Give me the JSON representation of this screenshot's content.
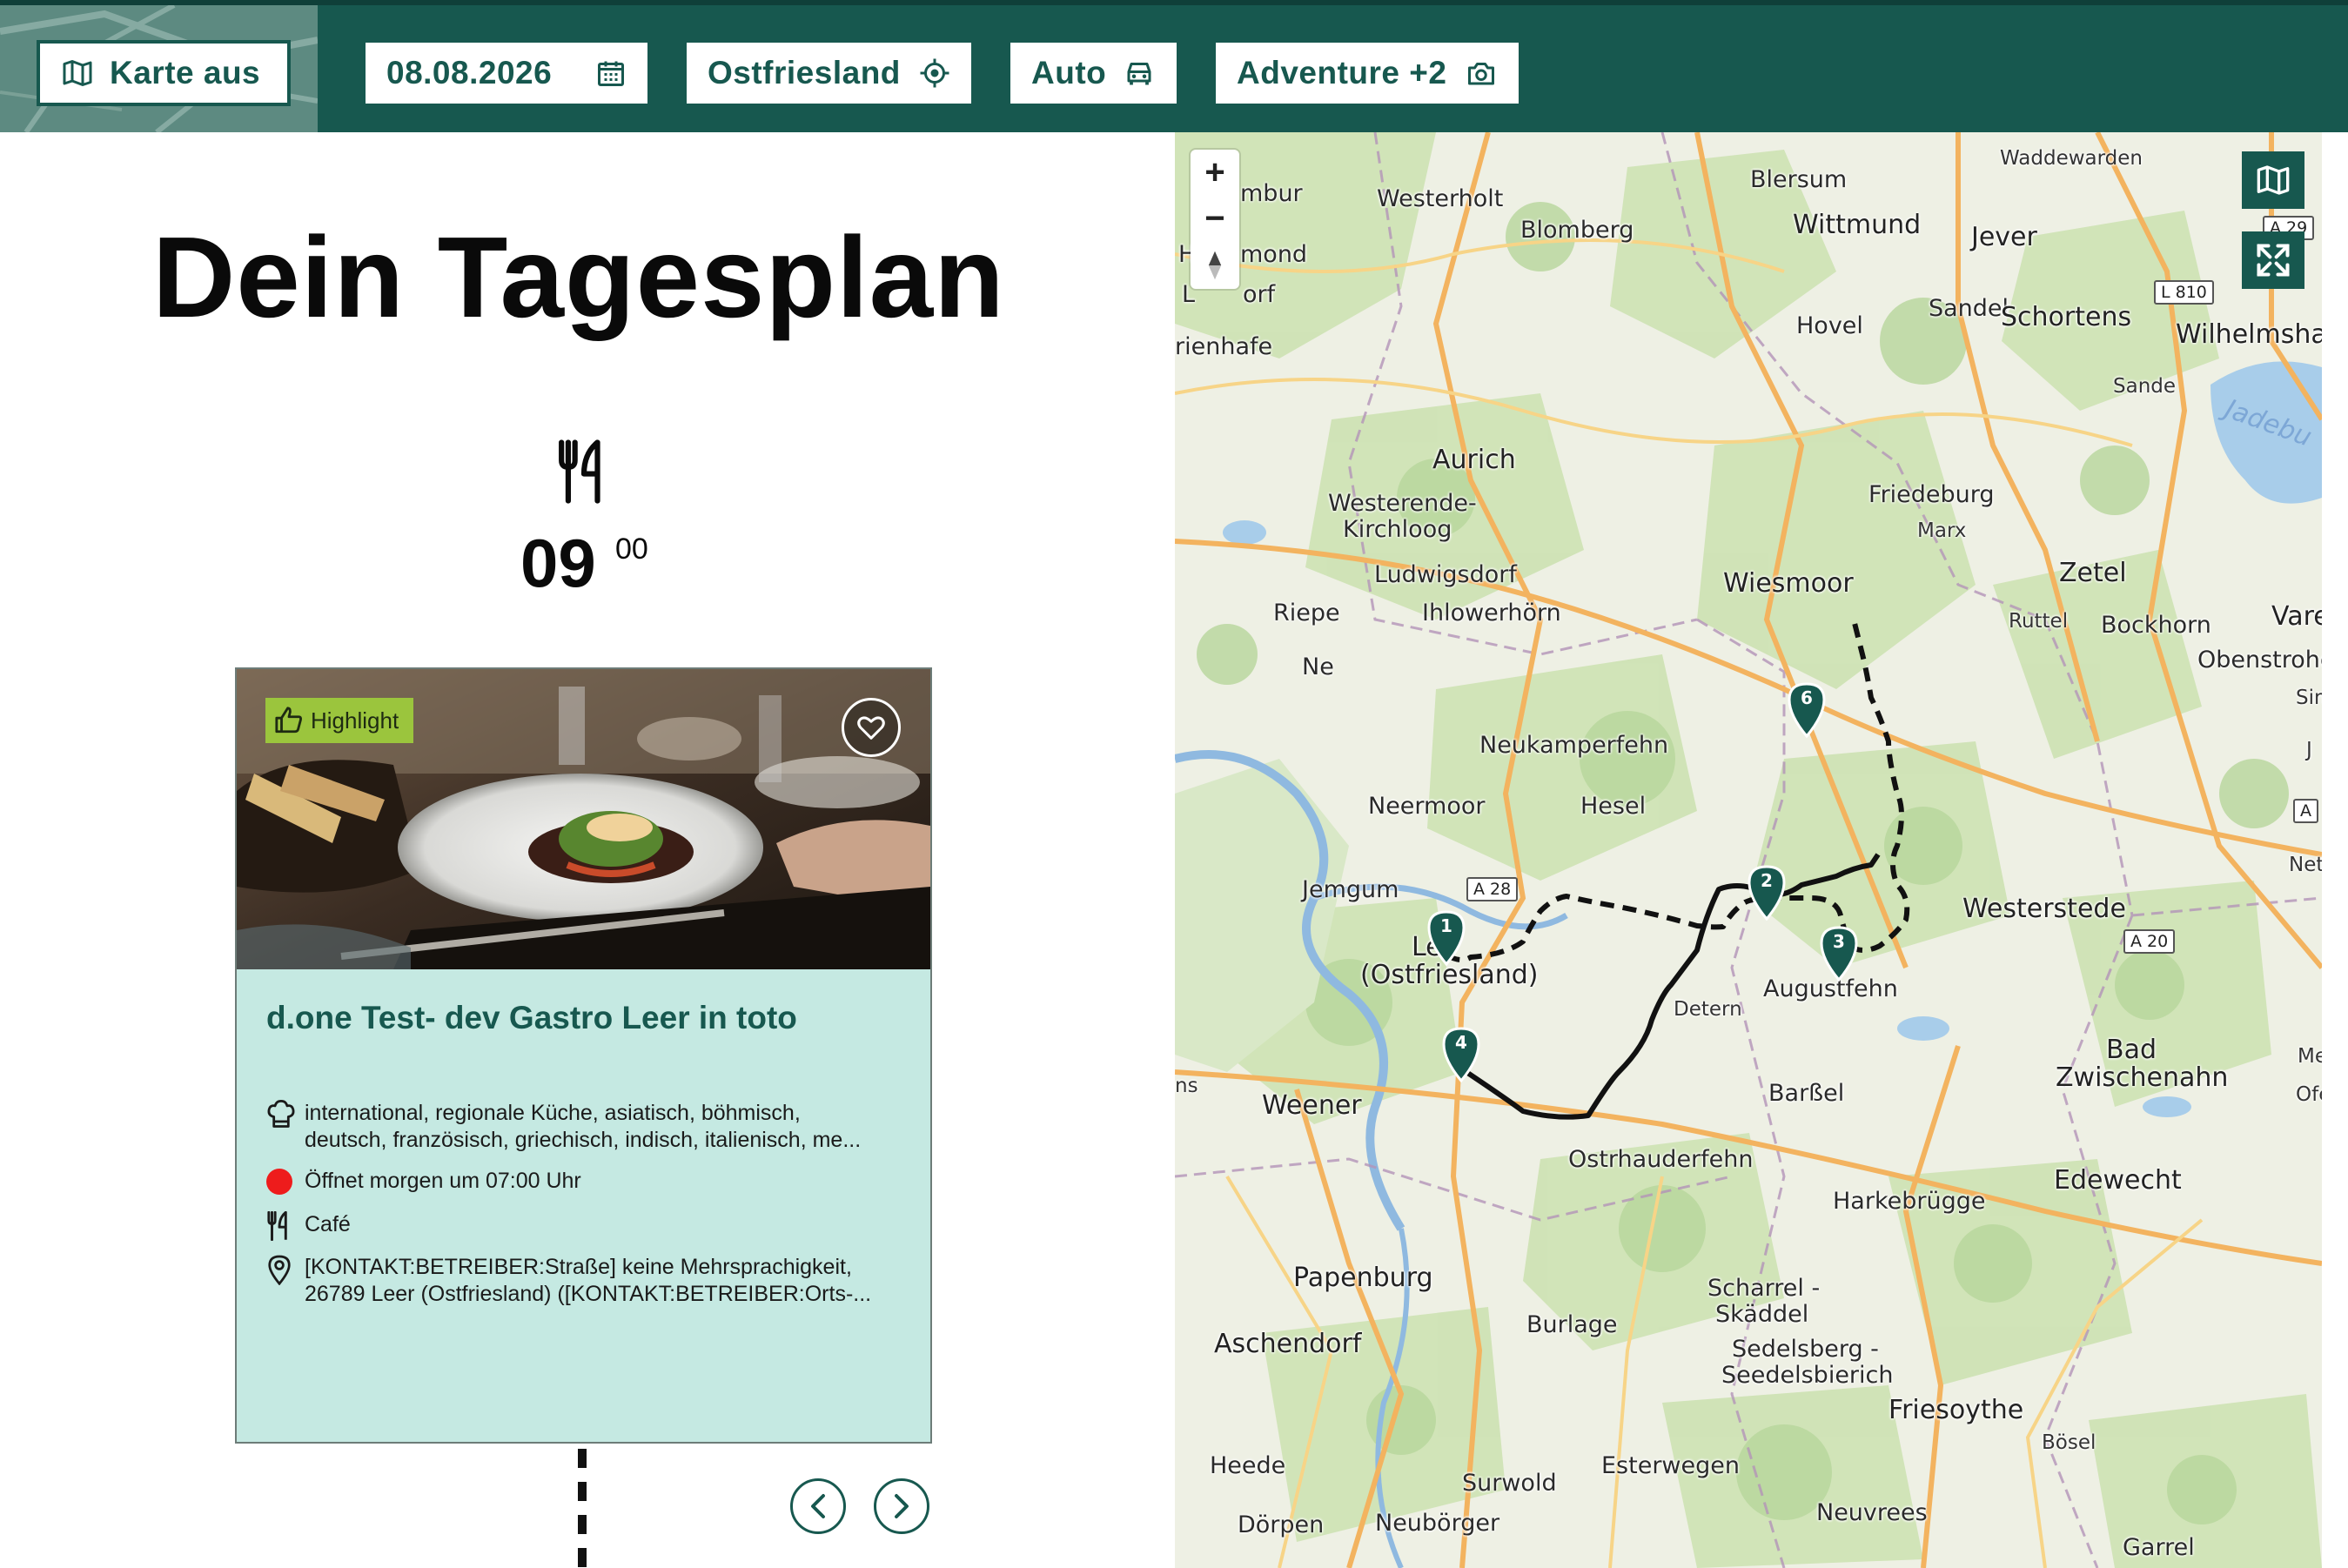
{
  "toolbar": {
    "map_toggle_label": "Karte aus",
    "date_label": "08.08.2026",
    "region_label": "Ostfriesland",
    "transport_label": "Auto",
    "tags_label": "Adventure +2"
  },
  "plan": {
    "title": "Dein Tagesplan",
    "time_hour": "09",
    "time_minute": "00",
    "card": {
      "badge_label": "Highlight",
      "title": "d.one Test- dev Gastro Leer in toto",
      "cuisine": "international, regionale Küche, asiatisch, böhmisch,",
      "cuisine_more": "deutsch, französisch, griechisch, indisch, italienisch, me...",
      "opening_status": "Öffnet morgen um 07:00 Uhr",
      "category": "Café",
      "address_line1": "[KONTAKT:BETREIBER:Straße] keine Mehrsprachigkeit,",
      "address_line2": "26789 Leer (Ostfriesland) ([KONTAKT:BETREIBER:Orts-..."
    }
  },
  "map": {
    "zoom_in": "+",
    "zoom_out": "−",
    "places": [
      {
        "id": "westerholt",
        "label": "Westerholt"
      },
      {
        "id": "blomberg",
        "label": "Blomberg"
      },
      {
        "id": "blersum",
        "label": "Blersum"
      },
      {
        "id": "wittmund",
        "label": "Wittmund"
      },
      {
        "id": "jever",
        "label": "Jever"
      },
      {
        "id": "waddewarden",
        "label": "Waddewarden"
      },
      {
        "id": "hovel",
        "label": "Hovel"
      },
      {
        "id": "sandel",
        "label": "Sandel"
      },
      {
        "id": "schortens",
        "label": "Schortens"
      },
      {
        "id": "wilhelmshaven",
        "label": "Wilhelmshave"
      },
      {
        "id": "sande",
        "label": "Sande"
      },
      {
        "id": "jadebu",
        "label": "Jadebu"
      },
      {
        "id": "aurich",
        "label": "Aurich"
      },
      {
        "id": "westerende",
        "label": "Westerende-"
      },
      {
        "id": "kirchloog",
        "label": "Kirchloog"
      },
      {
        "id": "friedeburg",
        "label": "Friedeburg"
      },
      {
        "id": "marx",
        "label": "Marx"
      },
      {
        "id": "ludwigsdorf",
        "label": "Ludwigsdorf"
      },
      {
        "id": "zetel",
        "label": "Zetel"
      },
      {
        "id": "wiesmoor",
        "label": "Wiesmoor"
      },
      {
        "id": "riepe",
        "label": "Riepe"
      },
      {
        "id": "ihlowerhoern",
        "label": "Ihlowerhörn"
      },
      {
        "id": "ruttel",
        "label": "Ruttel"
      },
      {
        "id": "bockhorn",
        "label": "Bockhorn"
      },
      {
        "id": "vare",
        "label": "Vare"
      },
      {
        "id": "obenstrohe",
        "label": "Obenstrohe"
      },
      {
        "id": "simonswolde",
        "label": "Simonswolde"
      },
      {
        "id": "ne",
        "label": "Ne"
      },
      {
        "id": "neukamperfehn",
        "label": "Neukamperfehn"
      },
      {
        "id": "neermoor",
        "label": "Neermoor"
      },
      {
        "id": "hesel",
        "label": "Hesel"
      },
      {
        "id": "jemgum",
        "label": "Jemgum"
      },
      {
        "id": "nethe",
        "label": "Nethe"
      },
      {
        "id": "westerstede",
        "label": "Westerstede"
      },
      {
        "id": "leer1",
        "label": "Le"
      },
      {
        "id": "leer2",
        "label": "(Ostfriesland)"
      },
      {
        "id": "augustfehn",
        "label": "Augustfehn"
      },
      {
        "id": "detern",
        "label": "Detern"
      },
      {
        "id": "bad",
        "label": "Bad"
      },
      {
        "id": "zwischenahn",
        "label": "Zwischenahn"
      },
      {
        "id": "me",
        "label": "Me"
      },
      {
        "id": "ofe",
        "label": "Ofe"
      },
      {
        "id": "weener",
        "label": "Weener"
      },
      {
        "id": "barssel",
        "label": "Barßel"
      },
      {
        "id": "ostrhauderfehn",
        "label": "Ostrhauderfehn"
      },
      {
        "id": "harkebruegge",
        "label": "Harkebrügge"
      },
      {
        "id": "edewecht",
        "label": "Edewecht"
      },
      {
        "id": "papenburg",
        "label": "Papenburg"
      },
      {
        "id": "scharrel",
        "label": "Scharrel -"
      },
      {
        "id": "skaeddel",
        "label": "Skäddel"
      },
      {
        "id": "burlage",
        "label": "Burlage"
      },
      {
        "id": "aschendorf",
        "label": "Aschendorf"
      },
      {
        "id": "sedelsberg",
        "label": "Sedelsberg -"
      },
      {
        "id": "seedelsbierich",
        "label": "Seedelsbierich"
      },
      {
        "id": "friesoythe",
        "label": "Friesoythe"
      },
      {
        "id": "boesel",
        "label": "Bösel"
      },
      {
        "id": "heede",
        "label": "Heede"
      },
      {
        "id": "esterwegen",
        "label": "Esterwegen"
      },
      {
        "id": "surwold",
        "label": "Surwold"
      },
      {
        "id": "doerpen",
        "label": "Dörpen"
      },
      {
        "id": "neuboerger",
        "label": "Neubörger"
      },
      {
        "id": "neuvrees",
        "label": "Neuvrees"
      },
      {
        "id": "garrel",
        "label": "Garrel"
      },
      {
        "id": "mbur",
        "label": "mbur"
      },
      {
        "id": "h",
        "label": "H"
      },
      {
        "id": "mond",
        "label": "mond"
      },
      {
        "id": "l",
        "label": "L"
      },
      {
        "id": "orf",
        "label": "orf"
      },
      {
        "id": "rienhafe",
        "label": "rienhafe"
      },
      {
        "id": "ns",
        "label": "ns"
      },
      {
        "id": "j",
        "label": "J"
      }
    ],
    "road_shields": [
      {
        "id": "a29",
        "label": "A 29"
      },
      {
        "id": "l810",
        "label": "L 810"
      },
      {
        "id": "a28",
        "label": "A 28"
      },
      {
        "id": "a20",
        "label": "A 20"
      },
      {
        "id": "a_edge",
        "label": "A"
      }
    ],
    "stops": [
      {
        "number": "1"
      },
      {
        "number": "2"
      },
      {
        "number": "3"
      },
      {
        "number": "4"
      },
      {
        "number": "6"
      }
    ]
  },
  "colors": {
    "brand_green": "#17584f",
    "card_bg": "#c5e9e2",
    "badge_green": "#9bc53d",
    "closed_red": "#ee1c1c"
  }
}
